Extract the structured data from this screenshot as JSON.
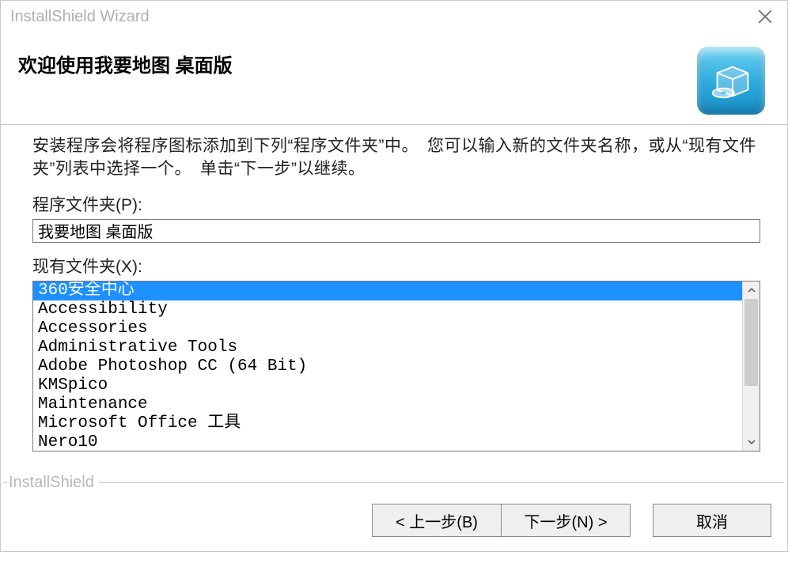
{
  "window": {
    "title": "InstallShield Wizard"
  },
  "header": {
    "welcome": "欢迎使用我要地图 桌面版"
  },
  "body": {
    "instructions": "安装程序会将程序图标添加到下列“程序文件夹”中。　您可以输入新的文件夹名称，或从“现有文件夹”列表中选择一个。　单击“下一步”以继续。",
    "program_folder_label": "程序文件夹(P):",
    "program_folder_value": "我要地图 桌面版",
    "existing_folders_label": "现有文件夹(X):",
    "folders": [
      "360安全中心",
      "Accessibility",
      "Accessories",
      "Administrative Tools",
      "Adobe Photoshop CC (64 Bit)",
      "KMSpico",
      "Maintenance",
      "Microsoft Office 工具",
      "Nero10"
    ],
    "selected_index": 0
  },
  "footer": {
    "brand": "InstallShield",
    "back": "< 上一步(B)",
    "next": "下一步(N) >",
    "cancel": "取消"
  }
}
